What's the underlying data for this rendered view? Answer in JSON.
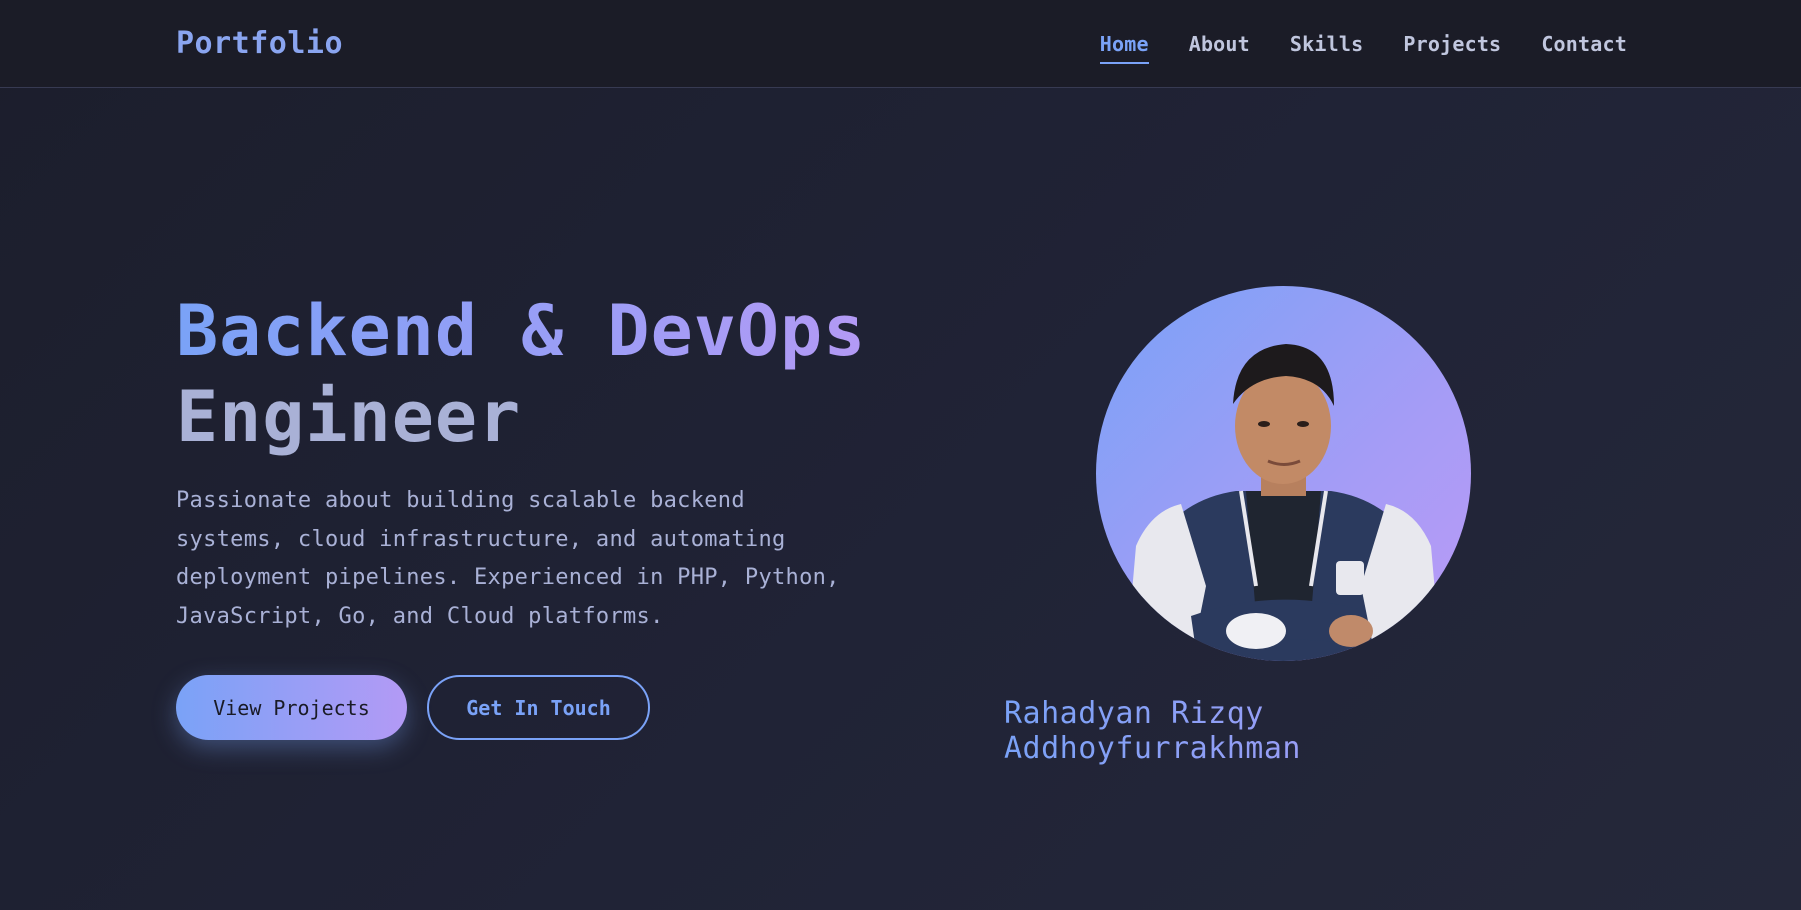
{
  "navbar": {
    "logo": "Portfolio",
    "links": [
      {
        "label": "Home",
        "active": true
      },
      {
        "label": "About",
        "active": false
      },
      {
        "label": "Skills",
        "active": false
      },
      {
        "label": "Projects",
        "active": false
      },
      {
        "label": "Contact",
        "active": false
      }
    ]
  },
  "hero": {
    "title_line1": "Backend & DevOps",
    "title_line2": "Engineer",
    "description": "Passionate about building scalable backend systems, cloud infrastructure, and automating deployment pipelines. Experienced in PHP, Python, JavaScript, Go, and Cloud platforms.",
    "primary_button": "View Projects",
    "secondary_button": "Get In Touch"
  },
  "profile": {
    "name": "Rahadyan Rizqy Addhoyfurrakhman",
    "avatar_icon": "profile-photo"
  },
  "colors": {
    "accent_blue": "#7aa2f7",
    "accent_purple": "#b39af5",
    "background": "#1f2133",
    "text": "#a9b1d6"
  }
}
